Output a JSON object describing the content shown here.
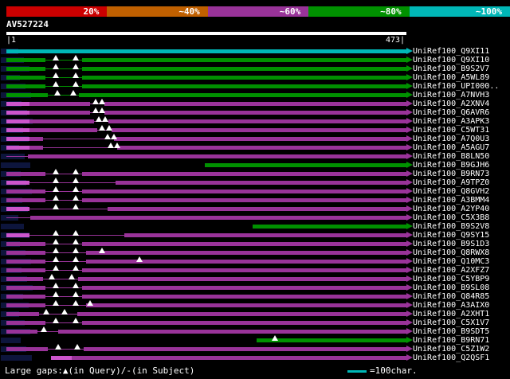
{
  "key": {
    "segments": [
      {
        "label": "20%",
        "color": "#cc0000"
      },
      {
        "label": "~40%",
        "color": "#c06000"
      },
      {
        "label": "~60%",
        "color": "#993399"
      },
      {
        "label": "~80%",
        "color": "#009100"
      },
      {
        "label": "~100%",
        "color": "#00b7b7"
      }
    ]
  },
  "query": {
    "name": "AV527224",
    "ruler_start": "|1",
    "ruler_end": "473|",
    "length": 473
  },
  "footer": {
    "gap_legend": "Large gaps:▲(in Query)/-(in Subject)",
    "scale_text": "=100char.",
    "scale_color": "#00b7b7"
  },
  "chart_data": {
    "type": "alignment-map",
    "title": "AV527224 similarity search hit map vs UniRef100",
    "query": {
      "name": "AV527224",
      "length": 473
    },
    "x_axis": {
      "min": 1,
      "max": 473,
      "units": "characters",
      "scale_bar": "100 characters"
    },
    "identity_legend": [
      {
        "label": "20%",
        "color": "#cc0000"
      },
      {
        "label": "~40%",
        "color": "#c06000"
      },
      {
        "label": "~60%",
        "color": "#993399"
      },
      {
        "label": "~80%",
        "color": "#009100"
      },
      {
        "label": "~100%",
        "color": "#00b7b7"
      }
    ],
    "colors": {
      "cyan": "#00b7b7",
      "green": "#009100",
      "purple": "#993399",
      "bright": "#cc55cc"
    },
    "rows": [
      {
        "label": "UniRef100_Q9XI11",
        "color": "cyan",
        "identity": "~100%",
        "start": 1,
        "end": 473,
        "segments": [
          [
            1,
            473,
            "thick"
          ]
        ],
        "query_gaps": []
      },
      {
        "label": "UniRef100_Q9XI10",
        "color": "green",
        "identity": "~80%",
        "start": 1,
        "end": 473,
        "segments": [
          [
            1,
            47,
            "thick"
          ],
          [
            47,
            90,
            "thin"
          ],
          [
            90,
            473,
            "thick"
          ]
        ],
        "query_gaps": [
          59,
          83
        ]
      },
      {
        "label": "UniRef100_B9S2V7",
        "color": "green",
        "identity": "~80%",
        "start": 1,
        "end": 473,
        "segments": [
          [
            1,
            47,
            "thick"
          ],
          [
            47,
            90,
            "thin"
          ],
          [
            90,
            473,
            "thick"
          ]
        ],
        "query_gaps": [
          59,
          83
        ]
      },
      {
        "label": "UniRef100_A5WL89",
        "color": "green",
        "identity": "~80%",
        "start": 1,
        "end": 473,
        "segments": [
          [
            1,
            47,
            "thick"
          ],
          [
            47,
            90,
            "thin"
          ],
          [
            90,
            473,
            "thick"
          ]
        ],
        "query_gaps": [
          59,
          83
        ]
      },
      {
        "label": "UniRef100_UPI000..",
        "color": "green",
        "identity": "~80%",
        "start": 1,
        "end": 473,
        "segments": [
          [
            1,
            47,
            "thick"
          ],
          [
            47,
            90,
            "thin"
          ],
          [
            90,
            473,
            "thick"
          ]
        ],
        "query_gaps": [
          59,
          83
        ]
      },
      {
        "label": "UniRef100_A7NVH3",
        "color": "green",
        "identity": "~80%",
        "start": 1,
        "end": 473,
        "segments": [
          [
            1,
            50,
            "thick"
          ],
          [
            50,
            87,
            "thin"
          ],
          [
            87,
            473,
            "thick"
          ]
        ],
        "query_gaps": [
          61,
          80
        ]
      },
      {
        "label": "UniRef100_A2XNV4",
        "color": "purple",
        "identity": "~60%",
        "start": 1,
        "end": 473,
        "segments": [
          [
            1,
            28,
            "bright"
          ],
          [
            28,
            100,
            "thick"
          ],
          [
            100,
            117,
            "thin"
          ],
          [
            117,
            473,
            "thick"
          ]
        ],
        "query_gaps": [
          106,
          114
        ]
      },
      {
        "label": "UniRef100_Q6AVR6",
        "color": "purple",
        "identity": "~60%",
        "start": 1,
        "end": 473,
        "segments": [
          [
            1,
            28,
            "bright"
          ],
          [
            28,
            100,
            "thick"
          ],
          [
            100,
            117,
            "thin"
          ],
          [
            117,
            473,
            "thick"
          ]
        ],
        "query_gaps": [
          106,
          114
        ]
      },
      {
        "label": "UniRef100_A3APK3",
        "color": "purple",
        "identity": "~60%",
        "start": 1,
        "end": 473,
        "segments": [
          [
            1,
            28,
            "bright"
          ],
          [
            28,
            104,
            "thick"
          ],
          [
            104,
            121,
            "thin"
          ],
          [
            121,
            473,
            "thick"
          ]
        ],
        "query_gaps": [
          110,
          118
        ]
      },
      {
        "label": "UniRef100_C5WT31",
        "color": "purple",
        "identity": "~60%",
        "start": 1,
        "end": 473,
        "segments": [
          [
            1,
            28,
            "bright"
          ],
          [
            28,
            108,
            "thick"
          ],
          [
            108,
            125,
            "thin"
          ],
          [
            125,
            473,
            "thick"
          ]
        ],
        "query_gaps": [
          114,
          122
        ]
      },
      {
        "label": "UniRef100_A7Q0U3",
        "color": "purple",
        "identity": "~60%",
        "start": 1,
        "end": 473,
        "segments": [
          [
            1,
            28,
            "bright"
          ],
          [
            28,
            44,
            "thick"
          ],
          [
            44,
            128,
            "thin"
          ],
          [
            128,
            473,
            "thick"
          ]
        ],
        "query_gaps": [
          120,
          128
        ]
      },
      {
        "label": "UniRef100_A5AGU7",
        "color": "purple",
        "identity": "~60%",
        "start": 1,
        "end": 473,
        "segments": [
          [
            1,
            28,
            "bright"
          ],
          [
            28,
            44,
            "thick"
          ],
          [
            44,
            132,
            "thin"
          ],
          [
            132,
            473,
            "thick"
          ]
        ],
        "query_gaps": [
          124,
          132
        ]
      },
      {
        "label": "UniRef100_B8LN50",
        "color": "purple",
        "identity": "~60%",
        "start": 26,
        "end": 473,
        "segments": [
          [
            1,
            26,
            "thin"
          ],
          [
            26,
            473,
            "thick"
          ]
        ],
        "query_gaps": []
      },
      {
        "label": "UniRef100_B9GJH6",
        "color": "green",
        "identity": "~80%",
        "start": 235,
        "end": 473,
        "segments": [
          [
            235,
            473,
            "thick"
          ]
        ],
        "query_gaps": []
      },
      {
        "label": "UniRef100_B9RN73",
        "color": "purple",
        "identity": "~60%",
        "start": 1,
        "end": 473,
        "segments": [
          [
            1,
            47,
            "thick"
          ],
          [
            47,
            90,
            "thin"
          ],
          [
            90,
            473,
            "thick"
          ]
        ],
        "query_gaps": [
          59,
          83
        ]
      },
      {
        "label": "UniRef100_A9TPZ0",
        "color": "purple",
        "identity": "~60%",
        "start": 1,
        "end": 473,
        "segments": [
          [
            1,
            28,
            "bright"
          ],
          [
            28,
            130,
            "thin"
          ],
          [
            130,
            473,
            "thick"
          ]
        ],
        "query_gaps": [
          59,
          83
        ]
      },
      {
        "label": "UniRef100_Q8GVH2",
        "color": "purple",
        "identity": "~60%",
        "start": 1,
        "end": 473,
        "segments": [
          [
            1,
            47,
            "thick"
          ],
          [
            47,
            90,
            "thin"
          ],
          [
            90,
            473,
            "thick"
          ]
        ],
        "query_gaps": [
          59,
          83
        ]
      },
      {
        "label": "UniRef100_A3BMM4",
        "color": "purple",
        "identity": "~60%",
        "start": 1,
        "end": 473,
        "segments": [
          [
            1,
            47,
            "thick"
          ],
          [
            47,
            90,
            "thin"
          ],
          [
            90,
            473,
            "thick"
          ]
        ],
        "query_gaps": [
          59,
          83
        ]
      },
      {
        "label": "UniRef100_A2YP40",
        "color": "purple",
        "identity": "~60%",
        "start": 1,
        "end": 473,
        "segments": [
          [
            1,
            28,
            "bright"
          ],
          [
            28,
            120,
            "thin"
          ],
          [
            120,
            473,
            "thick"
          ]
        ],
        "query_gaps": [
          59,
          83
        ]
      },
      {
        "label": "UniRef100_C5X3B8",
        "color": "purple",
        "identity": "~60%",
        "start": 29,
        "end": 473,
        "segments": [
          [
            1,
            29,
            "thin"
          ],
          [
            29,
            473,
            "thick"
          ]
        ],
        "query_gaps": []
      },
      {
        "label": "UniRef100_B9S2V8",
        "color": "green",
        "identity": "~80%",
        "start": 292,
        "end": 473,
        "segments": [
          [
            292,
            473,
            "thick"
          ]
        ],
        "query_gaps": []
      },
      {
        "label": "UniRef100_Q9SY15",
        "color": "purple",
        "identity": "~60%",
        "start": 1,
        "end": 473,
        "segments": [
          [
            1,
            28,
            "bright"
          ],
          [
            28,
            140,
            "thin"
          ],
          [
            140,
            473,
            "thick"
          ]
        ],
        "query_gaps": [
          59,
          83
        ]
      },
      {
        "label": "UniRef100_B9S1D3",
        "color": "purple",
        "identity": "~60%",
        "start": 1,
        "end": 473,
        "segments": [
          [
            1,
            47,
            "thick"
          ],
          [
            47,
            90,
            "thin"
          ],
          [
            90,
            473,
            "thick"
          ]
        ],
        "query_gaps": [
          59,
          83
        ]
      },
      {
        "label": "UniRef100_Q8RWX8",
        "color": "purple",
        "identity": "~60%",
        "start": 1,
        "end": 473,
        "segments": [
          [
            1,
            47,
            "thick"
          ],
          [
            47,
            95,
            "thin"
          ],
          [
            95,
            473,
            "thick"
          ]
        ],
        "query_gaps": [
          59,
          83,
          114
        ]
      },
      {
        "label": "UniRef100_Q10MC3",
        "color": "purple",
        "identity": "~60%",
        "start": 1,
        "end": 473,
        "segments": [
          [
            1,
            47,
            "thick"
          ],
          [
            47,
            95,
            "thin"
          ],
          [
            95,
            473,
            "thick"
          ]
        ],
        "query_gaps": [
          59,
          83,
          158
        ]
      },
      {
        "label": "UniRef100_A2XFZ7",
        "color": "purple",
        "identity": "~60%",
        "start": 1,
        "end": 473,
        "segments": [
          [
            1,
            47,
            "thick"
          ],
          [
            47,
            90,
            "thin"
          ],
          [
            90,
            473,
            "thick"
          ]
        ],
        "query_gaps": [
          59,
          83
        ]
      },
      {
        "label": "UniRef100_C5YBP9",
        "color": "purple",
        "identity": "~60%",
        "start": 1,
        "end": 473,
        "segments": [
          [
            1,
            44,
            "thick"
          ],
          [
            44,
            86,
            "thin"
          ],
          [
            86,
            473,
            "thick"
          ]
        ],
        "query_gaps": [
          55,
          78
        ]
      },
      {
        "label": "UniRef100_B9SL08",
        "color": "purple",
        "identity": "~60%",
        "start": 1,
        "end": 473,
        "segments": [
          [
            1,
            47,
            "thick"
          ],
          [
            47,
            90,
            "thin"
          ],
          [
            90,
            473,
            "thick"
          ]
        ],
        "query_gaps": [
          59,
          83
        ]
      },
      {
        "label": "UniRef100_Q84R85",
        "color": "purple",
        "identity": "~60%",
        "start": 1,
        "end": 473,
        "segments": [
          [
            1,
            47,
            "thick"
          ],
          [
            47,
            90,
            "thin"
          ],
          [
            90,
            473,
            "thick"
          ]
        ],
        "query_gaps": [
          59,
          83
        ]
      },
      {
        "label": "UniRef100_A3AIX0",
        "color": "purple",
        "identity": "~60%",
        "start": 1,
        "end": 473,
        "segments": [
          [
            1,
            47,
            "thick"
          ],
          [
            47,
            95,
            "thin"
          ],
          [
            95,
            473,
            "thick"
          ]
        ],
        "query_gaps": [
          59,
          83,
          100
        ]
      },
      {
        "label": "UniRef100_A2XHT1",
        "color": "purple",
        "identity": "~60%",
        "start": 1,
        "end": 473,
        "segments": [
          [
            1,
            40,
            "thick"
          ],
          [
            40,
            85,
            "thin"
          ],
          [
            85,
            473,
            "thick"
          ]
        ],
        "query_gaps": [
          48,
          70
        ]
      },
      {
        "label": "UniRef100_C5X1V7",
        "color": "purple",
        "identity": "~60%",
        "start": 1,
        "end": 473,
        "segments": [
          [
            1,
            47,
            "thick"
          ],
          [
            47,
            90,
            "thin"
          ],
          [
            90,
            473,
            "thick"
          ]
        ],
        "query_gaps": [
          59,
          83
        ]
      },
      {
        "label": "UniRef100_B9SDT5",
        "color": "purple",
        "identity": "~60%",
        "start": 1,
        "end": 473,
        "segments": [
          [
            1,
            38,
            "thick"
          ],
          [
            38,
            62,
            "thin"
          ],
          [
            62,
            473,
            "thick"
          ]
        ],
        "query_gaps": [
          45
        ]
      },
      {
        "label": "UniRef100_B9RN71",
        "color": "green",
        "identity": "~80%",
        "start": 296,
        "end": 473,
        "segments": [
          [
            296,
            473,
            "thick"
          ]
        ],
        "query_gaps": [
          318
        ]
      },
      {
        "label": "UniRef100_C5Z1W2",
        "color": "purple",
        "identity": "~60%",
        "start": 1,
        "end": 473,
        "segments": [
          [
            1,
            50,
            "thick"
          ],
          [
            50,
            92,
            "thin"
          ],
          [
            92,
            473,
            "thick"
          ]
        ],
        "query_gaps": [
          62,
          85
        ]
      },
      {
        "label": "UniRef100_Q2QSF1",
        "color": "purple",
        "identity": "~60%",
        "start": 54,
        "end": 473,
        "segments": [
          [
            54,
            78,
            "bright"
          ],
          [
            78,
            473,
            "thick"
          ]
        ],
        "query_gaps": []
      }
    ]
  }
}
